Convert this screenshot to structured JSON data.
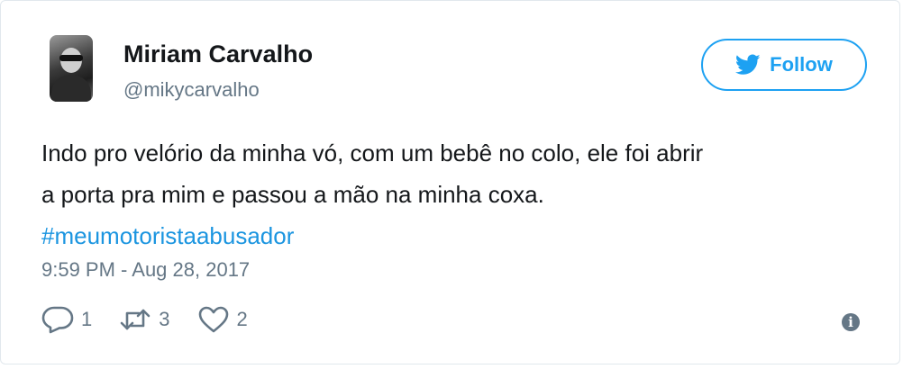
{
  "author": {
    "name": "Miriam Carvalho",
    "handle": "@mikycarvalho"
  },
  "follow_button": {
    "label": "Follow",
    "color": "#1da1f2"
  },
  "tweet": {
    "text_line_1": "Indo pro velório da minha vó, com um bebê no colo, ele foi abrir",
    "text_line_2": "a porta pra mim e passou a mão na minha coxa.",
    "hashtag": "#meumotoristaabusador",
    "timestamp": "9:59 PM - Aug 28, 2017"
  },
  "actions": {
    "reply_count": "1",
    "retweet_count": "3",
    "like_count": "2"
  },
  "icons": {
    "follow": "bird-icon",
    "reply": "reply-icon",
    "retweet": "retweet-icon",
    "like": "heart-icon",
    "info": "info-icon"
  },
  "colors": {
    "link": "#1b95e0",
    "muted": "#657786",
    "text": "#14171a"
  }
}
